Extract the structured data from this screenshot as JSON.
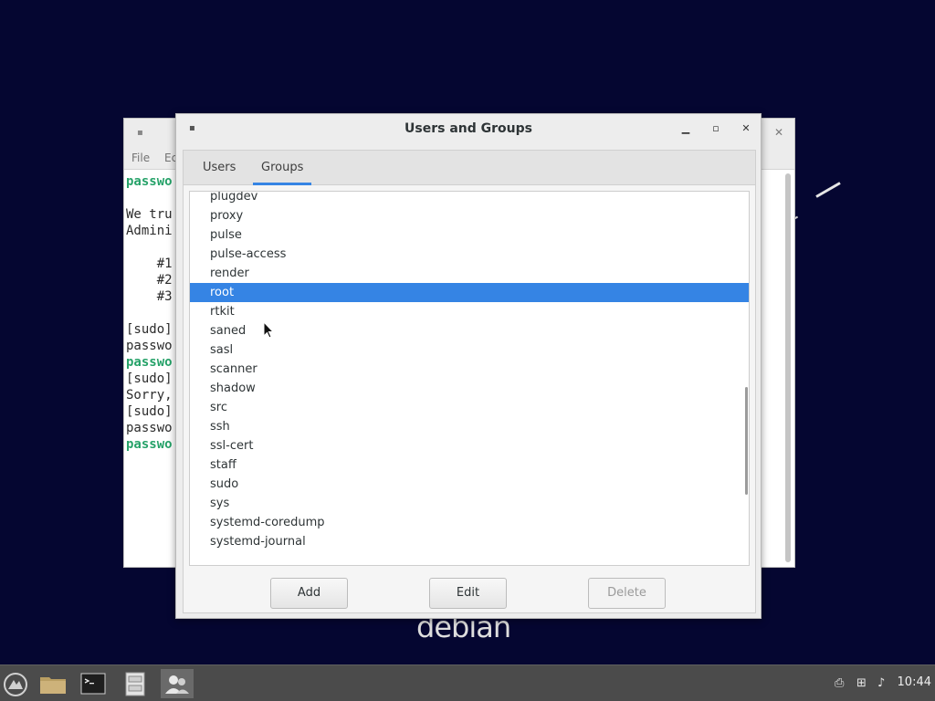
{
  "dialog": {
    "title": "Users and Groups",
    "tabs": [
      {
        "label": "Users",
        "active": false
      },
      {
        "label": "Groups",
        "active": true
      }
    ],
    "groups": [
      {
        "name": "plugdev"
      },
      {
        "name": "proxy"
      },
      {
        "name": "pulse"
      },
      {
        "name": "pulse-access"
      },
      {
        "name": "render"
      },
      {
        "name": "root",
        "selected": true
      },
      {
        "name": "rtkit"
      },
      {
        "name": "saned"
      },
      {
        "name": "sasl"
      },
      {
        "name": "scanner"
      },
      {
        "name": "shadow"
      },
      {
        "name": "src"
      },
      {
        "name": "ssh"
      },
      {
        "name": "ssl-cert"
      },
      {
        "name": "staff"
      },
      {
        "name": "sudo"
      },
      {
        "name": "sys"
      },
      {
        "name": "systemd-coredump"
      },
      {
        "name": "systemd-journal"
      }
    ],
    "buttons": {
      "add": "Add",
      "edit": "Edit",
      "delete": "Delete",
      "delete_enabled": false
    }
  },
  "terminal": {
    "menu": [
      "File",
      "Ec"
    ],
    "lines": [
      {
        "text": "passwo",
        "highlight": true
      },
      {
        "text": "",
        "highlight": false
      },
      {
        "text": "We tru",
        "highlight": false
      },
      {
        "text": "Admini",
        "highlight": false
      },
      {
        "text": "",
        "highlight": false
      },
      {
        "text": "    #1",
        "highlight": false
      },
      {
        "text": "    #2",
        "highlight": false
      },
      {
        "text": "    #3",
        "highlight": false
      },
      {
        "text": "",
        "highlight": false
      },
      {
        "text": "[sudo]",
        "highlight": false
      },
      {
        "text": "passwo",
        "highlight": false
      },
      {
        "text": "passwo",
        "highlight": true
      },
      {
        "text": "[sudo]",
        "highlight": false
      },
      {
        "text": "Sorry,",
        "highlight": false
      },
      {
        "text": "[sudo]",
        "highlight": false
      },
      {
        "text": "passwo",
        "highlight": false
      },
      {
        "text": "passwo",
        "highlight": true
      }
    ]
  },
  "desktop": {
    "wallpaper_text": "debian"
  },
  "taskbar": {
    "clock": "10:44"
  },
  "colors": {
    "selection": "#3584e4",
    "desktop_bg": "#050631",
    "prompt_green": "#26a269"
  }
}
